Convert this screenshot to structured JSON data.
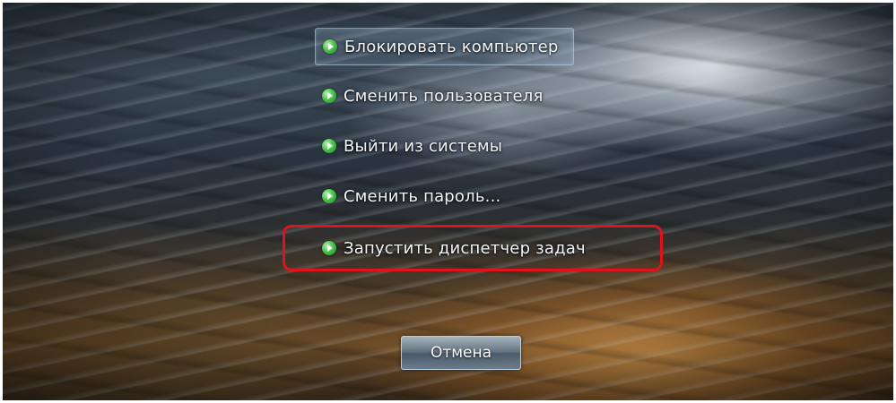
{
  "security_menu": {
    "items": [
      {
        "label": "Блокировать компьютер",
        "icon": "green-arrow-icon"
      },
      {
        "label": "Сменить пользователя",
        "icon": "green-arrow-icon"
      },
      {
        "label": "Выйти из системы",
        "icon": "green-arrow-icon"
      },
      {
        "label": "Сменить пароль...",
        "icon": "green-arrow-icon"
      },
      {
        "label": "Запустить диспетчер задач",
        "icon": "green-arrow-icon",
        "highlighted": true
      }
    ],
    "cancel_label": "Отмена",
    "highlight_color": "#e0121b"
  }
}
